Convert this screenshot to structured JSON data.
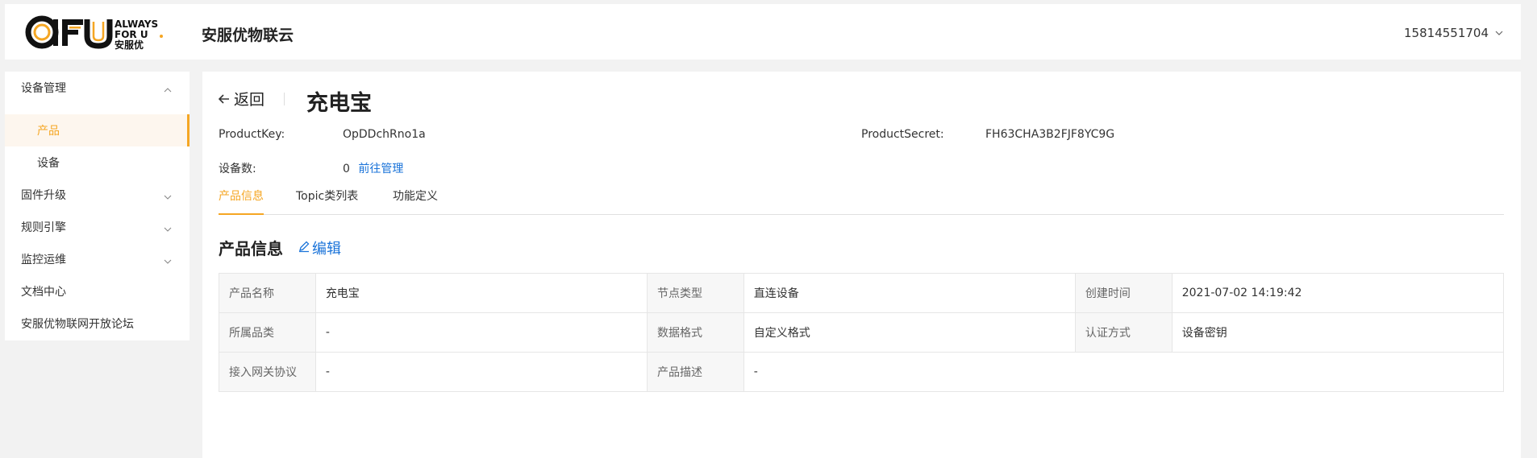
{
  "header": {
    "logo_text": "AFU",
    "logo_tagline_line1": "ALWAYS",
    "logo_tagline_line2": "FOR U",
    "logo_tagline_line3": "安服优",
    "brand": "安服优物联云",
    "user": "15814551704"
  },
  "sidebar": {
    "items": [
      {
        "label": "设备管理",
        "expanded": true
      },
      {
        "label": "产品",
        "active": true
      },
      {
        "label": "设备"
      },
      {
        "label": "固件升级"
      },
      {
        "label": "规则引擎"
      },
      {
        "label": "监控运维"
      },
      {
        "label": "文档中心"
      },
      {
        "label": "安服优物联网开放论坛"
      }
    ]
  },
  "main": {
    "back_label": "返回",
    "title": "充电宝",
    "product_key_label": "ProductKey:",
    "product_key": "OpDDchRno1a",
    "product_secret_label": "ProductSecret:",
    "product_secret": "FH63CHA3B2FJF8YC9G",
    "device_count_label": "设备数:",
    "device_count": "0",
    "manage_link": "前往管理",
    "tabs": [
      {
        "label": "产品信息",
        "active": true
      },
      {
        "label": "Topic类列表"
      },
      {
        "label": "功能定义"
      }
    ],
    "section_title": "产品信息",
    "edit_label": "编辑",
    "table": {
      "rows": [
        [
          {
            "label": "产品名称",
            "value": "充电宝"
          },
          {
            "label": "节点类型",
            "value": "直连设备"
          },
          {
            "label": "创建时间",
            "value": "2021-07-02 14:19:42"
          }
        ],
        [
          {
            "label": "所属品类",
            "value": "-"
          },
          {
            "label": "数据格式",
            "value": "自定义格式"
          },
          {
            "label": "认证方式",
            "value": "设备密钥"
          }
        ],
        [
          {
            "label": "接入网关协议",
            "value": "-"
          },
          {
            "label": "产品描述",
            "value": "-"
          }
        ]
      ]
    }
  },
  "colors": {
    "accent": "#f5a623",
    "link": "#1a73d9",
    "page_bg": "#f2f2f2"
  }
}
